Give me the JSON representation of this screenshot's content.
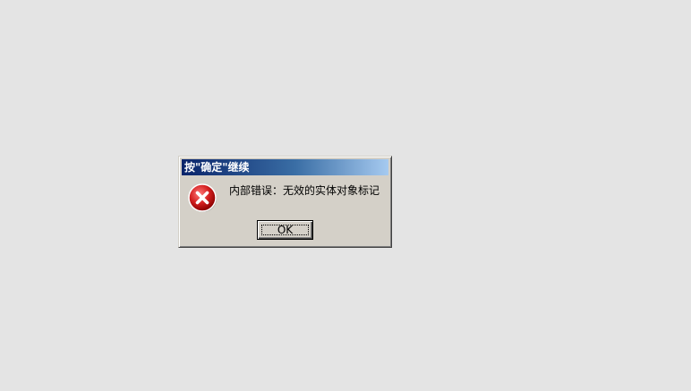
{
  "dialog": {
    "title": "按\"确定\"继续",
    "message": "内部错误：无效的实体对象标记",
    "icon": "error-icon",
    "ok_label": "OK"
  },
  "colors": {
    "desktop": "#e4e4e4",
    "dialog_face": "#d4d0c8",
    "title_start": "#0a246a",
    "title_end": "#a6caf0",
    "error_red": "#d42020"
  }
}
